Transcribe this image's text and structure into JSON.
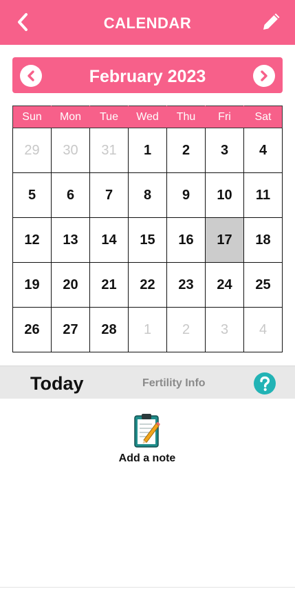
{
  "header": {
    "title": "CALENDAR",
    "back_icon": "chevron-left-icon",
    "edit_icon": "pencil-icon"
  },
  "month": {
    "label": "February 2023",
    "prev_icon": "chevron-left-circle-icon",
    "next_icon": "chevron-right-circle-icon"
  },
  "weekdays": [
    "Sun",
    "Mon",
    "Tue",
    "Wed",
    "Thu",
    "Fri",
    "Sat"
  ],
  "weeks": [
    [
      {
        "d": "29",
        "m": true
      },
      {
        "d": "30",
        "m": true
      },
      {
        "d": "31",
        "m": true
      },
      {
        "d": "1"
      },
      {
        "d": "2"
      },
      {
        "d": "3"
      },
      {
        "d": "4"
      }
    ],
    [
      {
        "d": "5"
      },
      {
        "d": "6"
      },
      {
        "d": "7"
      },
      {
        "d": "8"
      },
      {
        "d": "9"
      },
      {
        "d": "10"
      },
      {
        "d": "11"
      }
    ],
    [
      {
        "d": "12"
      },
      {
        "d": "13"
      },
      {
        "d": "14"
      },
      {
        "d": "15"
      },
      {
        "d": "16"
      },
      {
        "d": "17",
        "today": true
      },
      {
        "d": "18"
      }
    ],
    [
      {
        "d": "19"
      },
      {
        "d": "20"
      },
      {
        "d": "21"
      },
      {
        "d": "22"
      },
      {
        "d": "23"
      },
      {
        "d": "24"
      },
      {
        "d": "25"
      }
    ],
    [
      {
        "d": "26"
      },
      {
        "d": "27"
      },
      {
        "d": "28"
      },
      {
        "d": "1",
        "m": true
      },
      {
        "d": "2",
        "m": true
      },
      {
        "d": "3",
        "m": true
      },
      {
        "d": "4",
        "m": true
      }
    ]
  ],
  "info_bar": {
    "today_label": "Today",
    "fertility_label": "Fertility Info",
    "help_icon": "question-circle-icon"
  },
  "note": {
    "label": "Add a note",
    "icon": "clipboard-pencil-icon"
  },
  "colors": {
    "accent": "#f7608a",
    "help": "#22b3b5",
    "today_cell": "#cccccc"
  }
}
